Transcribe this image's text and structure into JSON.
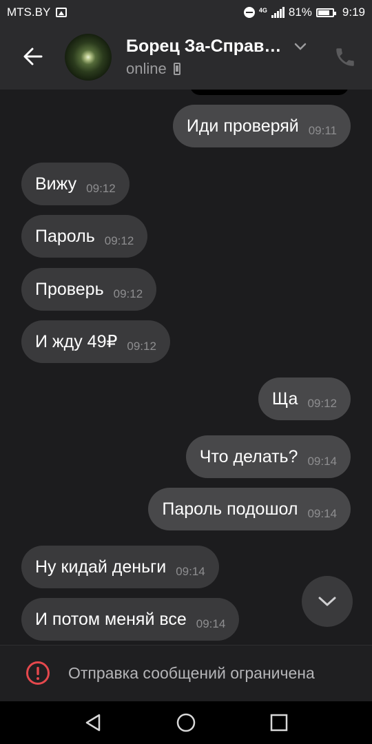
{
  "status_bar": {
    "carrier": "MTS.BY",
    "network": "4G",
    "battery": "81%",
    "time": "9:19",
    "icons": [
      "image-icon",
      "do-not-disturb-icon",
      "signal-icon",
      "battery-icon"
    ]
  },
  "header": {
    "contact_name": "Борец За-Справ…",
    "status": "online",
    "icons": [
      "back-arrow-icon",
      "chevron-down-icon",
      "mobile-device-icon",
      "phone-icon"
    ]
  },
  "messages": [
    {
      "direction": "out",
      "text": "Иди проверяй",
      "time": "09:11"
    },
    {
      "direction": "in",
      "text": "Вижу",
      "time": "09:12"
    },
    {
      "direction": "in",
      "text": "Пароль",
      "time": "09:12"
    },
    {
      "direction": "in",
      "text": "Проверь",
      "time": "09:12"
    },
    {
      "direction": "in",
      "text": "И жду 49₽",
      "time": "09:12"
    },
    {
      "direction": "out",
      "text": "Ща",
      "time": "09:12"
    },
    {
      "direction": "out",
      "text": "Что делать?",
      "time": "09:14"
    },
    {
      "direction": "out",
      "text": "Пароль подошол",
      "time": "09:14"
    },
    {
      "direction": "in",
      "text": "Ну кидай деньги",
      "time": "09:14"
    },
    {
      "direction": "in",
      "text": "И потом меняй все",
      "time": "09:14"
    }
  ],
  "restriction": {
    "text": "Отправка сообщений ограничена",
    "icon": "warning-icon",
    "color": "#e5484d"
  },
  "nav_bar": {
    "icons": [
      "nav-back-icon",
      "nav-home-icon",
      "nav-recent-icon"
    ]
  },
  "colors": {
    "background": "#1c1c1e",
    "header": "#2b2b2d",
    "incoming_bubble": "#3a3a3c",
    "outgoing_bubble": "#48484a"
  }
}
